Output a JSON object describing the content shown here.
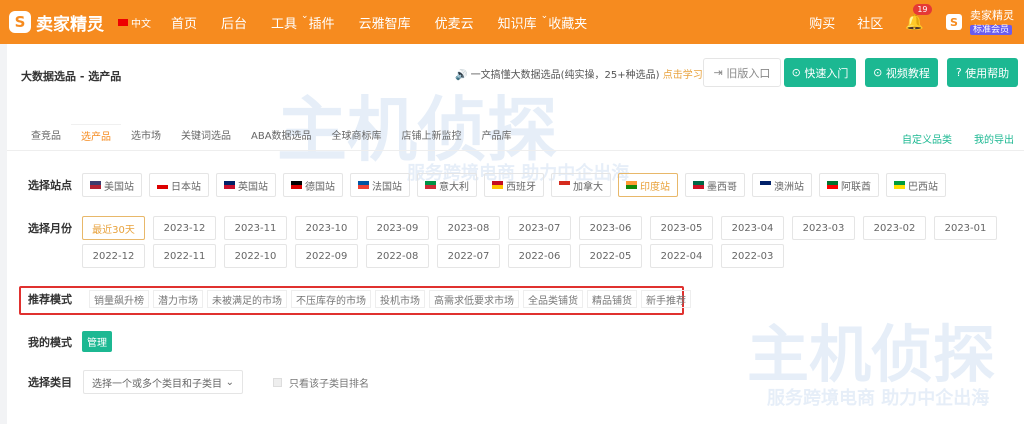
{
  "header": {
    "logo": "卖家精灵",
    "lang": "中文",
    "nav": [
      "首页",
      "后台",
      "工具",
      "插件",
      "云雅智库",
      "优麦云",
      "知识库",
      "收藏夹"
    ],
    "buy": "购买",
    "community": "社区",
    "notif_count": "19",
    "user_name": "卖家精灵",
    "user_level": "标准会员"
  },
  "page": {
    "title": "大数据选品 - 选产品",
    "notice": "一文搞懂大数据选品(纯实操，25+种选品)",
    "notice_link": "点击学习",
    "old_entry": "旧版入口",
    "quick_start": "快速入门",
    "video": "视频教程",
    "help": "使用帮助"
  },
  "tabs": [
    "查竞品",
    "选产品",
    "选市场",
    "关键词选品",
    "ABA数据选品",
    "全球商标库",
    "店铺上新监控",
    "产品库"
  ],
  "tabs_right": [
    "自定义品类",
    "我的导出"
  ],
  "sites": {
    "label": "选择站点",
    "items": [
      "美国站",
      "日本站",
      "英国站",
      "德国站",
      "法国站",
      "意大利",
      "西班牙",
      "加拿大",
      "印度站",
      "墨西哥",
      "澳洲站",
      "阿联酋",
      "巴西站"
    ],
    "selected": "印度站"
  },
  "months": {
    "label": "选择月份",
    "row1": [
      "最近30天",
      "2023-12",
      "2023-11",
      "2023-10",
      "2023-09",
      "2023-08",
      "2023-07",
      "2023-06",
      "2023-05",
      "2023-04",
      "2023-03",
      "2023-02",
      "2023-01"
    ],
    "row2": [
      "2022-12",
      "2022-11",
      "2022-10",
      "2022-09",
      "2022-08",
      "2022-07",
      "2022-06",
      "2022-05",
      "2022-04",
      "2022-03"
    ],
    "selected": "最近30天"
  },
  "modes": {
    "label": "推荐模式",
    "items": [
      "销量飙升榜",
      "潜力市场",
      "未被满足的市场",
      "不压库存的市场",
      "投机市场",
      "高需求低要求市场",
      "全品类铺货",
      "精品铺货",
      "新手推荐"
    ]
  },
  "my_mode": {
    "label": "我的模式",
    "manage": "管理"
  },
  "category": {
    "label": "选择类目",
    "placeholder": "选择一个或多个类目和子类目",
    "only_sub": "只看该子类目排名"
  },
  "watermark": {
    "brand": "主机侦探",
    "slogan": "服务跨境电商 助力中企出海"
  },
  "colors": {
    "brand": "#f68b1f",
    "accent": "#1cb892",
    "highlight": "#e0312f"
  }
}
